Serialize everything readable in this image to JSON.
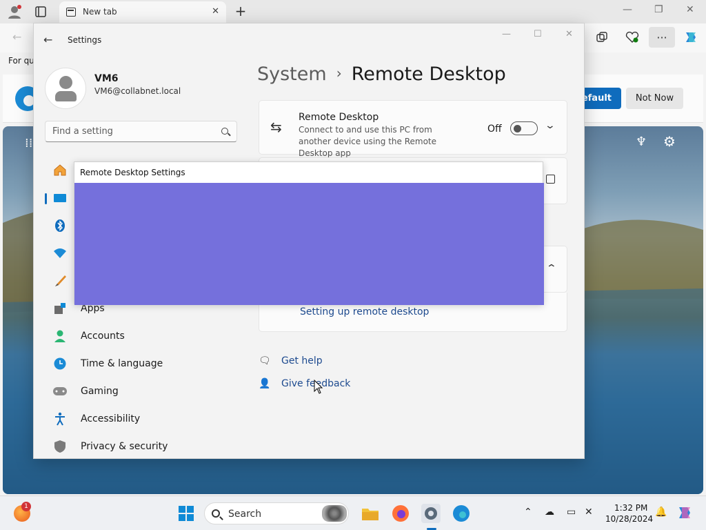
{
  "browser": {
    "tab_title": "New tab",
    "favorites_text": "For qu",
    "banner_primary_label": "default",
    "banner_secondary_label": "Not Now"
  },
  "settings": {
    "window_title": "Settings",
    "user": {
      "name": "VM6",
      "email": "VM6@collabnet.local"
    },
    "search": {
      "placeholder": "Find a setting"
    },
    "nav": [
      {
        "label": "",
        "icon": "home-icon"
      },
      {
        "label": "",
        "icon": "system-icon",
        "selected": true
      },
      {
        "label": "",
        "icon": "bluetooth-icon"
      },
      {
        "label": "",
        "icon": "network-icon"
      },
      {
        "label": "",
        "icon": "personalization-icon"
      },
      {
        "label": "Apps",
        "icon": "apps-icon"
      },
      {
        "label": "Accounts",
        "icon": "accounts-icon"
      },
      {
        "label": "Time & language",
        "icon": "time-language-icon"
      },
      {
        "label": "Gaming",
        "icon": "gaming-icon"
      },
      {
        "label": "Accessibility",
        "icon": "accessibility-icon"
      },
      {
        "label": "Privacy & security",
        "icon": "privacy-shield-icon"
      }
    ],
    "breadcrumb": {
      "parent": "System",
      "separator": "›",
      "page": "Remote Desktop"
    },
    "remote_desktop": {
      "title": "Remote Desktop",
      "description": "Connect to and use this PC from another device using the Remote Desktop app",
      "state": "Off"
    },
    "setup_link": "Setting up remote desktop",
    "help": {
      "get_help": "Get help",
      "give_feedback": "Give feedback"
    }
  },
  "dialog": {
    "title": "Remote Desktop Settings",
    "body_color": "#7570dc"
  },
  "taskbar": {
    "search_label": "Search",
    "time": "1:32 PM",
    "date": "10/28/2024",
    "notification_count": "1"
  },
  "colors": {
    "accent": "#0f6cbd",
    "link": "#1d4a8f"
  }
}
